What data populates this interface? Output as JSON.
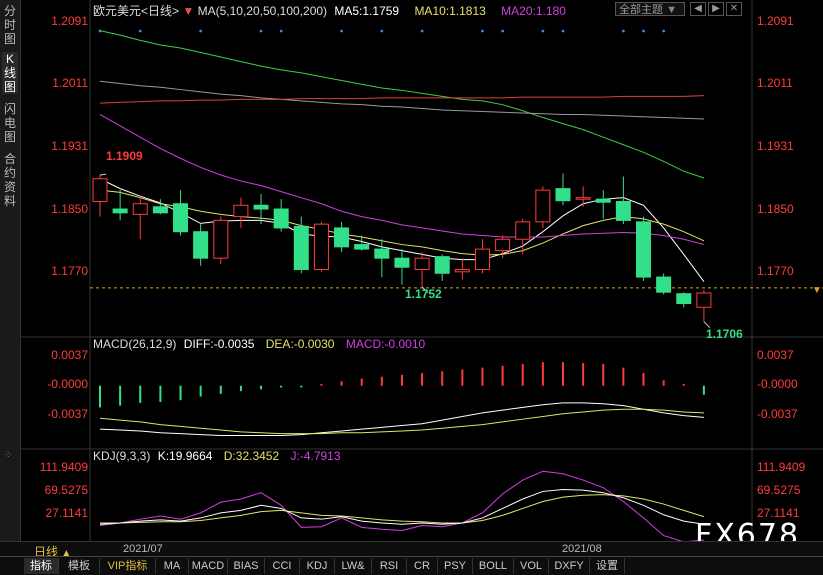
{
  "left_tabs": [
    {
      "label": "分时图",
      "active": false
    },
    {
      "label": "K线图",
      "active": true
    },
    {
      "label": "闪电图",
      "active": false
    },
    {
      "label": "合约资料",
      "active": false
    }
  ],
  "header": {
    "instrument": "欧元美元<日线>",
    "ma_title": "MA(5,10,20,50,100,200)",
    "ma5": "MA5:1.1759",
    "ma10": "MA10:1.1813",
    "ma20": "MA20:1.180",
    "theme_select": "全部主题"
  },
  "colors": {
    "up": "#ff3b3b",
    "down": "#33e08a",
    "ma5": "#ffffff",
    "ma10": "#e6e26a",
    "ma20": "#d040e0",
    "ma50": "#3ecf3e",
    "ma100": "#9a9a9a",
    "ma200": "#e04040",
    "diff": "#ffffff",
    "dea": "#e6e26a",
    "k": "#ffffff",
    "d": "#e6e26a",
    "j": "#d040e0"
  },
  "chart_data": [
    {
      "type": "candlestick",
      "title": "欧元美元<日线>",
      "ylim": [
        1.1695,
        1.2105
      ],
      "yticks": [
        "1.2091",
        "1.2011",
        "1.1931",
        "1.1850",
        "1.1770"
      ],
      "annotations": {
        "high": "1.1909",
        "low1": "1.1752",
        "low2": "1.1706"
      },
      "candles": [
        {
          "o": 1.1865,
          "h": 1.19,
          "l": 1.1845,
          "c": 1.1895
        },
        {
          "o": 1.1855,
          "h": 1.188,
          "l": 1.184,
          "c": 1.185
        },
        {
          "o": 1.1848,
          "h": 1.1872,
          "l": 1.1815,
          "c": 1.1862
        },
        {
          "o": 1.1858,
          "h": 1.1868,
          "l": 1.1848,
          "c": 1.185
        },
        {
          "o": 1.1862,
          "h": 1.188,
          "l": 1.182,
          "c": 1.1825
        },
        {
          "o": 1.1825,
          "h": 1.1835,
          "l": 1.178,
          "c": 1.179
        },
        {
          "o": 1.179,
          "h": 1.1845,
          "l": 1.1782,
          "c": 1.184
        },
        {
          "o": 1.1845,
          "h": 1.187,
          "l": 1.183,
          "c": 1.186
        },
        {
          "o": 1.186,
          "h": 1.1875,
          "l": 1.1835,
          "c": 1.1855
        },
        {
          "o": 1.1855,
          "h": 1.1868,
          "l": 1.1825,
          "c": 1.183
        },
        {
          "o": 1.1832,
          "h": 1.1845,
          "l": 1.177,
          "c": 1.1775
        },
        {
          "o": 1.1775,
          "h": 1.1838,
          "l": 1.1772,
          "c": 1.1835
        },
        {
          "o": 1.183,
          "h": 1.1838,
          "l": 1.1798,
          "c": 1.1805
        },
        {
          "o": 1.1808,
          "h": 1.182,
          "l": 1.18,
          "c": 1.1802
        },
        {
          "o": 1.1802,
          "h": 1.1815,
          "l": 1.1765,
          "c": 1.179
        },
        {
          "o": 1.179,
          "h": 1.1802,
          "l": 1.1755,
          "c": 1.1778
        },
        {
          "o": 1.1775,
          "h": 1.1798,
          "l": 1.1752,
          "c": 1.179
        },
        {
          "o": 1.1792,
          "h": 1.1795,
          "l": 1.176,
          "c": 1.177
        },
        {
          "o": 1.1772,
          "h": 1.179,
          "l": 1.1762,
          "c": 1.1775
        },
        {
          "o": 1.1775,
          "h": 1.1815,
          "l": 1.177,
          "c": 1.1802
        },
        {
          "o": 1.18,
          "h": 1.182,
          "l": 1.179,
          "c": 1.1815
        },
        {
          "o": 1.1815,
          "h": 1.1842,
          "l": 1.1795,
          "c": 1.1838
        },
        {
          "o": 1.1838,
          "h": 1.1885,
          "l": 1.183,
          "c": 1.188
        },
        {
          "o": 1.1882,
          "h": 1.1902,
          "l": 1.186,
          "c": 1.1866
        },
        {
          "o": 1.1868,
          "h": 1.1885,
          "l": 1.1858,
          "c": 1.187
        },
        {
          "o": 1.1868,
          "h": 1.188,
          "l": 1.1842,
          "c": 1.1864
        },
        {
          "o": 1.1865,
          "h": 1.1898,
          "l": 1.1835,
          "c": 1.184
        },
        {
          "o": 1.1838,
          "h": 1.1845,
          "l": 1.176,
          "c": 1.1765
        },
        {
          "o": 1.1765,
          "h": 1.177,
          "l": 1.1742,
          "c": 1.1745
        },
        {
          "o": 1.1743,
          "h": 1.1745,
          "l": 1.1725,
          "c": 1.173
        },
        {
          "o": 1.1725,
          "h": 1.1748,
          "l": 1.1706,
          "c": 1.1744
        }
      ],
      "series": [
        {
          "name": "MA5",
          "values": [
            1.1895,
            1.1882,
            1.1872,
            1.1863,
            1.185,
            1.1836,
            1.1839,
            1.184,
            1.184,
            1.1836,
            1.1822,
            1.1819,
            1.1818,
            1.1812,
            1.1805,
            1.18,
            1.1795,
            1.179,
            1.1788,
            1.1788,
            1.1796,
            1.1806,
            1.1825,
            1.1846,
            1.1862,
            1.1868,
            1.187,
            1.186,
            1.183,
            1.1795,
            1.1759
          ]
        },
        {
          "name": "MA10",
          "values": [
            1.188,
            1.1877,
            1.187,
            1.1862,
            1.1858,
            1.1852,
            1.1848,
            1.1845,
            1.1843,
            1.184,
            1.1833,
            1.1828,
            1.1822,
            1.1818,
            1.1813,
            1.1808,
            1.1805,
            1.18,
            1.1796,
            1.1794,
            1.1795,
            1.18,
            1.181,
            1.1822,
            1.1833,
            1.184,
            1.1845,
            1.1842,
            1.1835,
            1.1825,
            1.1813
          ]
        },
        {
          "name": "MA20",
          "values": [
            1.198,
            1.1965,
            1.195,
            1.1935,
            1.1922,
            1.191,
            1.19,
            1.1892,
            1.1886,
            1.1878,
            1.187,
            1.1862,
            1.1852,
            1.1845,
            1.184,
            1.1834,
            1.183,
            1.1826,
            1.1822,
            1.182,
            1.1818,
            1.1818,
            1.1818,
            1.182,
            1.1822,
            1.1823,
            1.1824,
            1.1823,
            1.182,
            1.1815,
            1.1808
          ]
        },
        {
          "name": "MA50",
          "values": [
            1.2091,
            1.2085,
            1.2078,
            1.2072,
            1.2068,
            1.2062,
            1.2056,
            1.205,
            1.2044,
            1.2039,
            1.2035,
            1.203,
            1.2025,
            1.202,
            1.2015,
            1.2012,
            1.2008,
            1.2004,
            1.2,
            1.1998,
            1.1993,
            1.1985,
            1.1976,
            1.1968,
            1.196,
            1.195,
            1.194,
            1.193,
            1.1918,
            1.1905,
            1.1896
          ]
        },
        {
          "name": "MA100",
          "values": [
            1.2024,
            1.2021,
            1.2018,
            1.2016,
            1.2013,
            1.201,
            1.2007,
            1.2005,
            1.2002,
            1.2,
            1.1998,
            1.1996,
            1.1994,
            1.1993,
            1.1991,
            1.199,
            1.1988,
            1.1986,
            1.1985,
            1.1984,
            1.1983,
            1.1982,
            1.1981,
            1.198,
            1.198,
            1.1979,
            1.1978,
            1.1977,
            1.1976,
            1.1975,
            1.1974
          ]
        },
        {
          "name": "MA200",
          "values": [
            1.1995,
            1.1996,
            1.1997,
            1.1998,
            1.1998,
            1.1999,
            1.1999,
            1.2,
            1.2,
            1.2,
            1.2001,
            1.2001,
            1.2001,
            1.2001,
            1.2002,
            1.2002,
            1.2002,
            1.2002,
            1.2002,
            1.2002,
            1.2002,
            1.2003,
            1.2003,
            1.2003,
            1.2003,
            1.2003,
            1.2004,
            1.2004,
            1.2004,
            1.2004,
            1.2005
          ]
        }
      ]
    },
    {
      "type": "macd",
      "title": "MACD(26,12,9)",
      "diff_label": "DIFF:-0.0035",
      "dea_label": "DEA:-0.0030",
      "macd_label": "MACD:-0.0010",
      "ylim": [
        -0.006,
        0.0045
      ],
      "yticks": [
        "0.0037",
        "-0.0000",
        "-0.0037"
      ],
      "hist": [
        -0.0024,
        -0.0022,
        -0.0019,
        -0.0018,
        -0.0016,
        -0.0012,
        -0.0009,
        -0.0006,
        -0.0004,
        -0.0002,
        -0.0002,
        0.0002,
        0.0005,
        0.0008,
        0.001,
        0.0012,
        0.0014,
        0.0016,
        0.0018,
        0.002,
        0.0022,
        0.0024,
        0.0026,
        0.0026,
        0.0025,
        0.0024,
        0.002,
        0.0014,
        0.0006,
        0.0002,
        -0.001
      ],
      "diff": [
        -0.0048,
        -0.0049,
        -0.005,
        -0.0052,
        -0.0053,
        -0.0054,
        -0.0055,
        -0.0055,
        -0.0055,
        -0.0055,
        -0.0054,
        -0.0052,
        -0.005,
        -0.0048,
        -0.0046,
        -0.0044,
        -0.0042,
        -0.0038,
        -0.0034,
        -0.003,
        -0.0027,
        -0.0024,
        -0.0021,
        -0.0019,
        -0.0019,
        -0.002,
        -0.0022,
        -0.0026,
        -0.003,
        -0.0033,
        -0.0035
      ],
      "dea": [
        -0.0036,
        -0.0038,
        -0.004,
        -0.0043,
        -0.0045,
        -0.0047,
        -0.0049,
        -0.0051,
        -0.0052,
        -0.0053,
        -0.0053,
        -0.0053,
        -0.0052,
        -0.0052,
        -0.0051,
        -0.005,
        -0.0049,
        -0.0047,
        -0.0045,
        -0.0043,
        -0.004,
        -0.0037,
        -0.0034,
        -0.0031,
        -0.0029,
        -0.0027,
        -0.0026,
        -0.0026,
        -0.0027,
        -0.0029,
        -0.003
      ]
    },
    {
      "type": "kdj",
      "title": "KDJ(9,3,3)",
      "k_label": "K:19.9664",
      "d_label": "D:32.3452",
      "j_label": "J:-4.7913",
      "ylim": [
        -5,
        125
      ],
      "yticks": [
        "111.9409",
        "69.5275",
        "27.1141"
      ],
      "k": [
        20,
        22,
        25,
        27,
        25,
        30,
        38,
        42,
        50,
        45,
        30,
        28,
        32,
        25,
        22,
        20,
        22,
        20,
        22,
        30,
        45,
        60,
        72,
        75,
        74,
        70,
        62,
        50,
        35,
        25,
        20
      ],
      "d": [
        22,
        22,
        23,
        24,
        24,
        26,
        30,
        34,
        40,
        42,
        38,
        34,
        33,
        30,
        27,
        25,
        24,
        22,
        22,
        26,
        34,
        45,
        56,
        63,
        66,
        67,
        65,
        60,
        52,
        42,
        32
      ],
      "j": [
        18,
        22,
        28,
        33,
        28,
        38,
        55,
        60,
        70,
        50,
        15,
        16,
        30,
        15,
        12,
        10,
        18,
        16,
        22,
        38,
        68,
        90,
        104,
        100,
        90,
        78,
        56,
        30,
        2,
        -8,
        -5
      ]
    }
  ],
  "dates": {
    "d1": "2021/07",
    "d2": "2021/08"
  },
  "period_label": "日线",
  "bottom_tabs": [
    "指标",
    "模板",
    "VIP指标",
    "MA",
    "MACD",
    "BIAS",
    "CCI",
    "KDJ",
    "LW&",
    "RSI",
    "CR",
    "PSY",
    "BOLL",
    "VOL",
    "DXFY",
    "设置"
  ],
  "watermark": "FX678"
}
